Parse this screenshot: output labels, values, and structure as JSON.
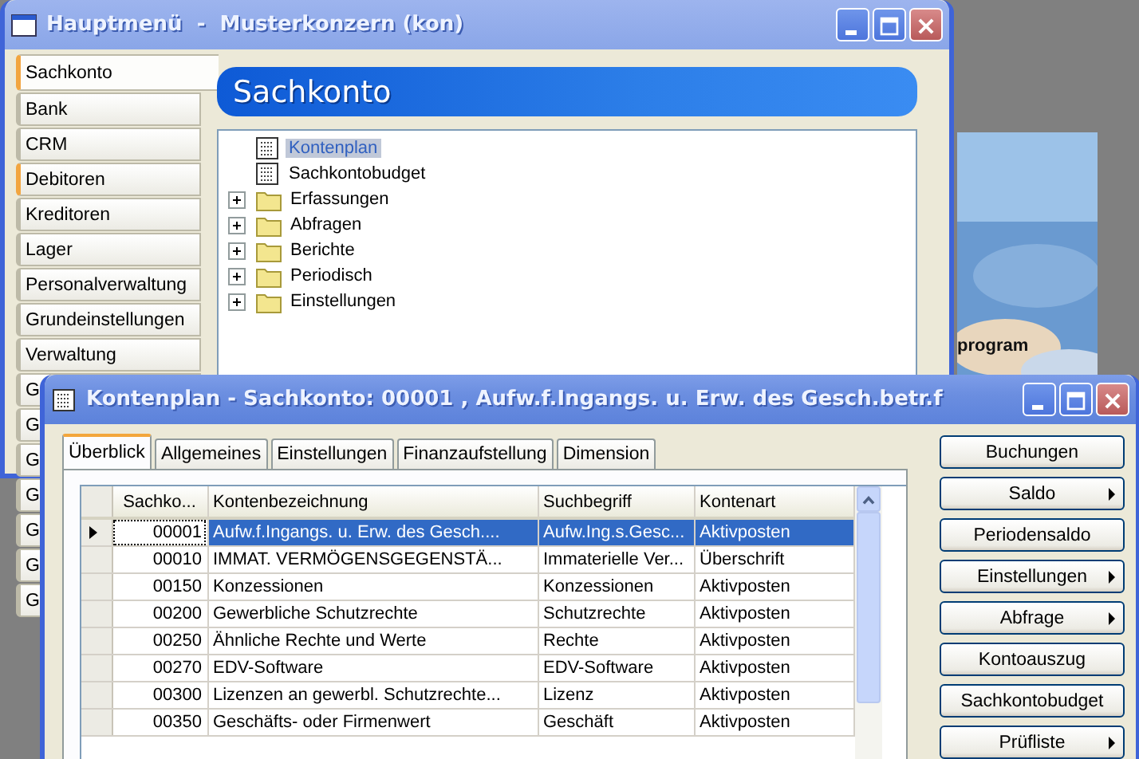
{
  "background_window": {
    "text": "program"
  },
  "main_window": {
    "title": "Hauptmenü  -  Musterkonzern (kon)",
    "nav": [
      {
        "label": "Sachkonto",
        "selected": true,
        "highlighted": true
      },
      {
        "label": "Bank",
        "selected": false,
        "highlighted": false
      },
      {
        "label": "CRM",
        "selected": false,
        "highlighted": false
      },
      {
        "label": "Debitoren",
        "selected": false,
        "highlighted": true
      },
      {
        "label": "Kreditoren",
        "selected": false,
        "highlighted": false
      },
      {
        "label": "Lager",
        "selected": false,
        "highlighted": false
      },
      {
        "label": "Personalverwaltung",
        "selected": false,
        "highlighted": false
      },
      {
        "label": "Grundeinstellungen",
        "selected": false,
        "highlighted": false
      },
      {
        "label": "Verwaltung",
        "selected": false,
        "highlighted": false
      },
      {
        "label": "G",
        "selected": false,
        "highlighted": false
      },
      {
        "label": "G",
        "selected": false,
        "highlighted": false
      },
      {
        "label": "G",
        "selected": false,
        "highlighted": false
      },
      {
        "label": "G",
        "selected": false,
        "highlighted": false
      },
      {
        "label": "G",
        "selected": false,
        "highlighted": false
      },
      {
        "label": "G",
        "selected": false,
        "highlighted": false
      },
      {
        "label": "G",
        "selected": false,
        "highlighted": false
      }
    ],
    "header": "Sachkonto",
    "tree": [
      {
        "label": "Kontenplan",
        "kind": "document",
        "expandable": false,
        "selected": true
      },
      {
        "label": "Sachkontobudget",
        "kind": "document",
        "expandable": false,
        "selected": false
      },
      {
        "label": "Erfassungen",
        "kind": "folder",
        "expandable": true,
        "selected": false
      },
      {
        "label": "Abfragen",
        "kind": "folder",
        "expandable": true,
        "selected": false
      },
      {
        "label": "Berichte",
        "kind": "folder",
        "expandable": true,
        "selected": false
      },
      {
        "label": "Periodisch",
        "kind": "folder",
        "expandable": true,
        "selected": false
      },
      {
        "label": "Einstellungen",
        "kind": "folder",
        "expandable": true,
        "selected": false
      }
    ]
  },
  "detail_window": {
    "title": "Kontenplan - Sachkonto: 00001 , Aufw.f.Ingangs. u. Erw. des Gesch.betr.f",
    "tabs": [
      {
        "label": "Überblick",
        "selected": true
      },
      {
        "label": "Allgemeines",
        "selected": false
      },
      {
        "label": "Einstellungen",
        "selected": false
      },
      {
        "label": "Finanzaufstellung",
        "selected": false
      },
      {
        "label": "Dimension",
        "selected": false
      }
    ],
    "table": {
      "columns": [
        "Sachko...",
        "Kontenbezeichnung",
        "Suchbegriff",
        "Kontenart"
      ],
      "rows": [
        {
          "cells": [
            "00001",
            "Aufw.f.Ingangs. u. Erw. des Gesch....",
            "Aufw.Ing.s.Gesc...",
            "Aktivposten"
          ],
          "selected": true,
          "current": true
        },
        {
          "cells": [
            "00010",
            "IMMAT. VERMÖGENSGEGENSTÄ...",
            "Immaterielle Ver...",
            "Überschrift"
          ],
          "selected": false,
          "current": false
        },
        {
          "cells": [
            "00150",
            "Konzessionen",
            "Konzessionen",
            "Aktivposten"
          ],
          "selected": false,
          "current": false
        },
        {
          "cells": [
            "00200",
            "Gewerbliche Schutzrechte",
            "Schutzrechte",
            "Aktivposten"
          ],
          "selected": false,
          "current": false
        },
        {
          "cells": [
            "00250",
            "Ähnliche Rechte und Werte",
            "Rechte",
            "Aktivposten"
          ],
          "selected": false,
          "current": false
        },
        {
          "cells": [
            "00270",
            "EDV-Software",
            "EDV-Software",
            "Aktivposten"
          ],
          "selected": false,
          "current": false
        },
        {
          "cells": [
            "00300",
            "Lizenzen an gewerbl. Schutzrechte...",
            "Lizenz",
            "Aktivposten"
          ],
          "selected": false,
          "current": false
        },
        {
          "cells": [
            "00350",
            "Geschäfts- oder Firmenwert",
            "Geschäft",
            "Aktivposten"
          ],
          "selected": false,
          "current": false
        }
      ]
    },
    "buttons": [
      {
        "label": "Buchungen",
        "has_menu": false
      },
      {
        "label": "Saldo",
        "has_menu": true
      },
      {
        "label": "Periodensaldo",
        "has_menu": false
      },
      {
        "label": "Einstellungen",
        "has_menu": true
      },
      {
        "label": "Abfrage",
        "has_menu": true
      },
      {
        "label": "Kontoauszug",
        "has_menu": false
      },
      {
        "label": "Sachkontobudget",
        "has_menu": false
      },
      {
        "label": "Prüfliste",
        "has_menu": true
      }
    ]
  }
}
